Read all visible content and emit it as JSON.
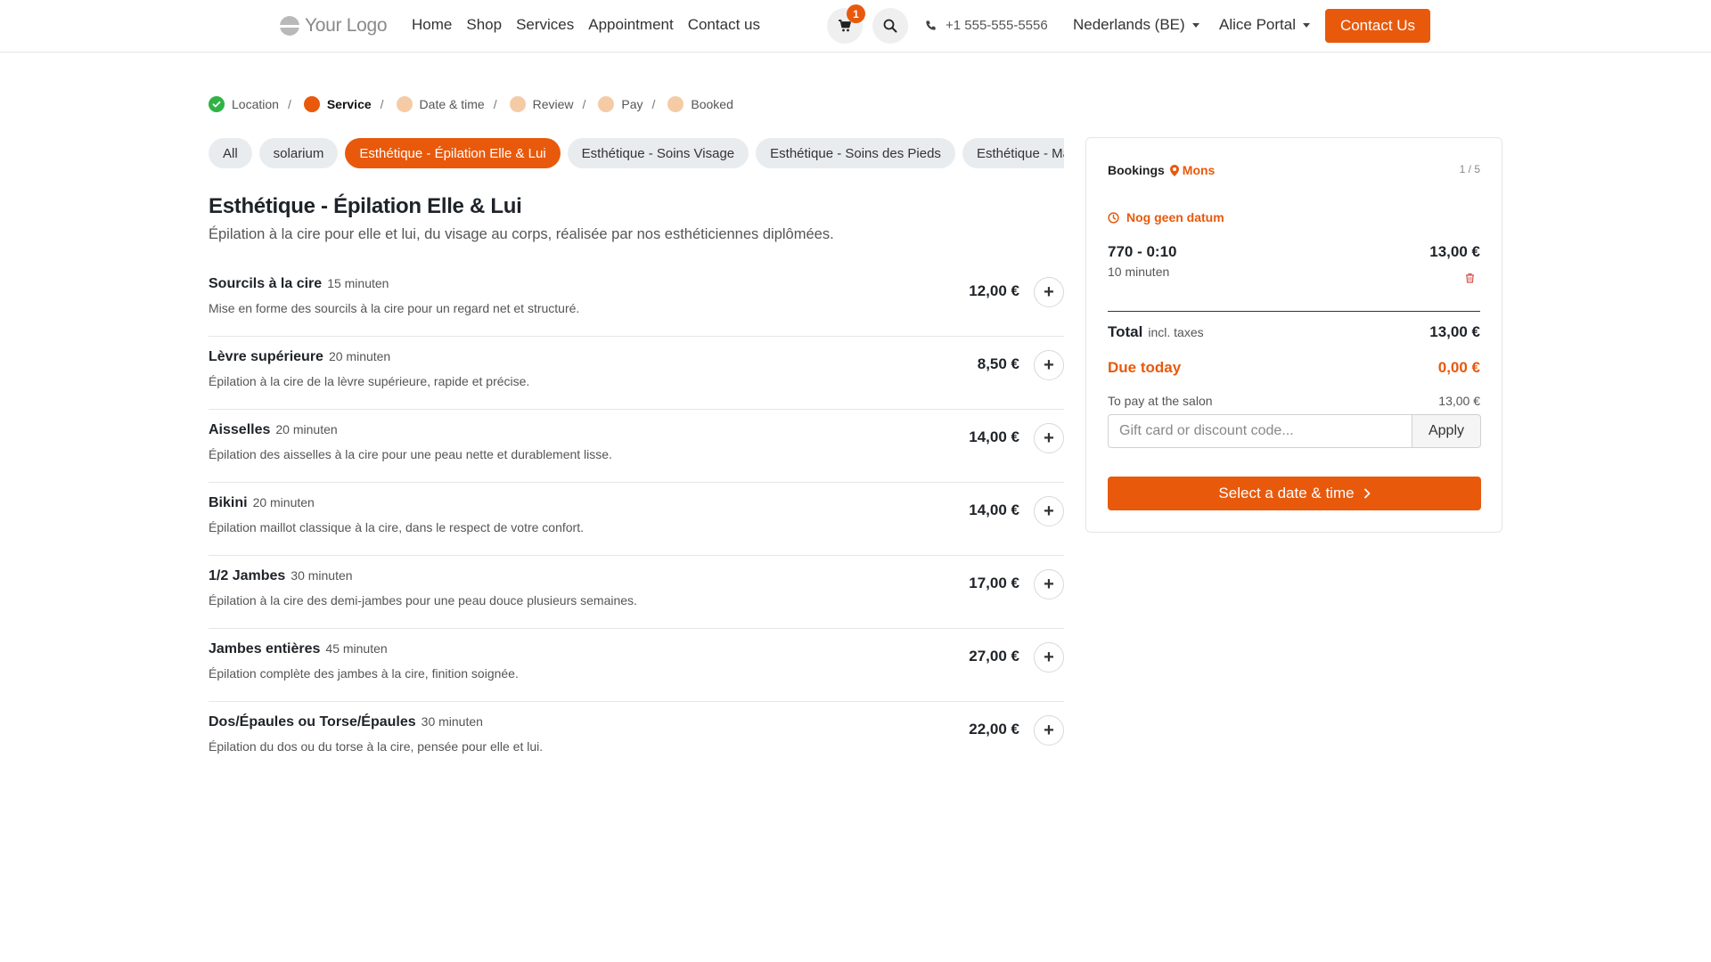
{
  "header": {
    "logo_text": "Your Logo",
    "nav": [
      "Home",
      "Shop",
      "Services",
      "Appointment",
      "Contact us"
    ],
    "cart_count": "1",
    "phone": "+1 555-555-5556",
    "language": "Nederlands (BE)",
    "portal": "Alice Portal",
    "contact_button": "Contact Us"
  },
  "steps": [
    {
      "label": "Location",
      "state": "done"
    },
    {
      "label": "Service",
      "state": "active"
    },
    {
      "label": "Date & time",
      "state": "pending"
    },
    {
      "label": "Review",
      "state": "pending"
    },
    {
      "label": "Pay",
      "state": "pending"
    },
    {
      "label": "Booked",
      "state": "pending"
    }
  ],
  "step_separator": "/",
  "chips": [
    {
      "label": "All",
      "active": false
    },
    {
      "label": "solarium",
      "active": false
    },
    {
      "label": "Esthétique - Épilation Elle & Lui",
      "active": true
    },
    {
      "label": "Esthétique - Soins Visage",
      "active": false
    },
    {
      "label": "Esthétique - Soins des Pieds",
      "active": false
    },
    {
      "label": "Esthétique - Manucure",
      "active": false
    }
  ],
  "category": {
    "title": "Esthétique - Épilation Elle & Lui",
    "description": "Épilation à la cire pour elle et lui, du visage au corps, réalisée par nos esthéticiennes diplômées."
  },
  "services": [
    {
      "name": "Sourcils à la cire",
      "duration": "15 minuten",
      "description": "Mise en forme des sourcils à la cire pour un regard net et structuré.",
      "price": "12,00 €"
    },
    {
      "name": "Lèvre supérieure",
      "duration": "20 minuten",
      "description": "Épilation à la cire de la lèvre supérieure, rapide et précise.",
      "price": "8,50 €"
    },
    {
      "name": "Aisselles",
      "duration": "20 minuten",
      "description": "Épilation des aisselles à la cire pour une peau nette et durablement lisse.",
      "price": "14,00 €"
    },
    {
      "name": "Bikini",
      "duration": "20 minuten",
      "description": "Épilation maillot classique à la cire, dans le respect de votre confort.",
      "price": "14,00 €"
    },
    {
      "name": "1/2 Jambes",
      "duration": "30 minuten",
      "description": "Épilation à la cire des demi-jambes pour une peau douce plusieurs semaines.",
      "price": "17,00 €"
    },
    {
      "name": "Jambes entières",
      "duration": "45 minuten",
      "description": "Épilation complète des jambes à la cire, finition soignée.",
      "price": "27,00 €"
    },
    {
      "name": "Dos/Épaules ou Torse/Épaules",
      "duration": "30 minuten",
      "description": "Épilation du dos ou du torse à la cire, pensée pour elle et lui.",
      "price": "22,00 €"
    }
  ],
  "booking": {
    "title": "Bookings",
    "location": "Mons",
    "count": "1 / 5",
    "no_date": "Nog geen datum",
    "item_name": "770 - 0:10",
    "item_duration": "10 minuten",
    "item_price": "13,00 €",
    "total_label": "Total",
    "total_note": "incl. taxes",
    "total_value": "13,00 €",
    "due_label": "Due today",
    "due_value": "0,00 €",
    "salon_label": "To pay at the salon",
    "salon_value": "13,00 €",
    "gift_placeholder": "Gift card or discount code...",
    "apply_label": "Apply",
    "cta_label": "Select a date & time"
  },
  "colors": {
    "accent": "#e8590c",
    "accent_light": "#f5cba6",
    "success": "#2fb344",
    "chip_bg": "#e9ecef"
  },
  "icons": [
    "logo-icon",
    "cart-icon",
    "search-icon",
    "phone-icon",
    "check-icon",
    "map-pin-icon",
    "clock-icon",
    "trash-icon",
    "plus-icon",
    "chevron-right-icon",
    "caret-down-icon"
  ]
}
